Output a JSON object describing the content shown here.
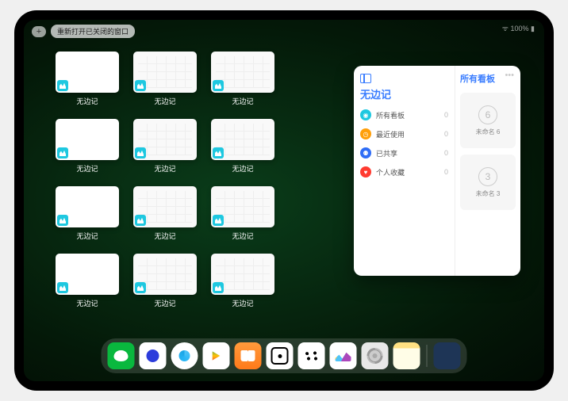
{
  "status_bar": {
    "indicators": "ᯤ 100% ▮"
  },
  "top_bar": {
    "plus_glyph": "+",
    "reopen_label": "重新打开已关闭的窗口"
  },
  "multitask": {
    "app_label": "无边记",
    "windows": [
      {
        "thumb": "blank"
      },
      {
        "thumb": "board"
      },
      {
        "thumb": "board"
      },
      {
        "thumb": "blank"
      },
      {
        "thumb": "board"
      },
      {
        "thumb": "board"
      },
      {
        "thumb": "blank"
      },
      {
        "thumb": "board"
      },
      {
        "thumb": "board"
      },
      {
        "thumb": "blank"
      },
      {
        "thumb": "board"
      },
      {
        "thumb": "board"
      }
    ]
  },
  "popover": {
    "left_title": "无边记",
    "filters": [
      {
        "icon_bg": "#1ec8e0",
        "glyph": "◉",
        "label": "所有看板",
        "count": "0"
      },
      {
        "icon_bg": "#ff9f0a",
        "glyph": "◷",
        "label": "最近使用",
        "count": "0"
      },
      {
        "icon_bg": "#2f6df6",
        "glyph": "⚉",
        "label": "已共享",
        "count": "0"
      },
      {
        "icon_bg": "#ff3b30",
        "glyph": "♥",
        "label": "个人收藏",
        "count": "0"
      }
    ],
    "right_title": "所有看板",
    "ellipsis": "•••",
    "boards": [
      {
        "sketch": "6",
        "name": "未命名 6"
      },
      {
        "sketch": "3",
        "name": "未命名 3"
      }
    ]
  },
  "dock": {
    "apps": [
      {
        "name": "wechat-icon",
        "cls": "ic-wechat"
      },
      {
        "name": "quark-icon",
        "cls": "ic-quark"
      },
      {
        "name": "browser-icon",
        "cls": "ic-browser"
      },
      {
        "name": "play-icon",
        "cls": "ic-play"
      },
      {
        "name": "books-icon",
        "cls": "ic-books"
      },
      {
        "name": "dice-icon",
        "cls": "ic-dot"
      },
      {
        "name": "graph-icon",
        "cls": "ic-graph"
      },
      {
        "name": "freeform-icon",
        "cls": "ic-freeform"
      },
      {
        "name": "settings-icon",
        "cls": "ic-settings"
      },
      {
        "name": "notes-icon",
        "cls": "ic-notes"
      }
    ]
  }
}
